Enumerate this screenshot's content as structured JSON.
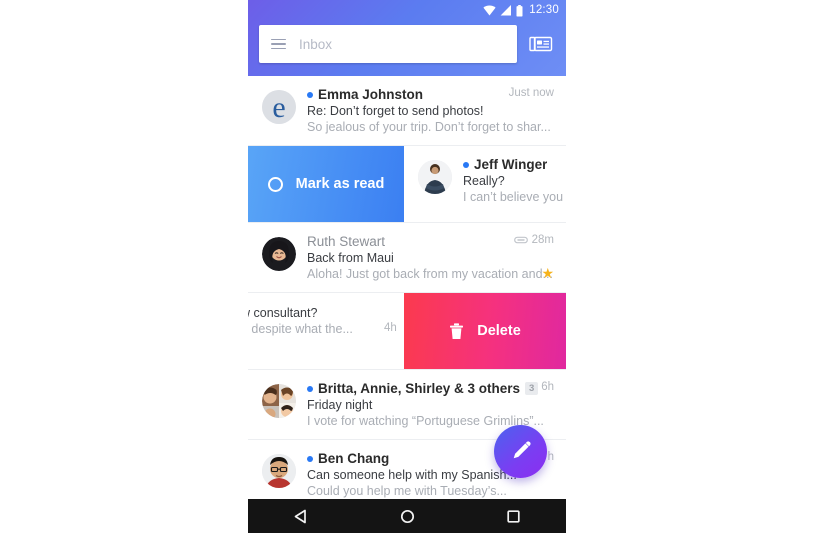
{
  "status_bar": {
    "time": "12:30",
    "icons": [
      "wifi-icon",
      "signal-icon",
      "battery-icon"
    ]
  },
  "header": {
    "accent_gradient_from": "#6d5ee8",
    "accent_gradient_to": "#6e8ef5",
    "search": {
      "placeholder": "Inbox",
      "menu_icon": "hamburger-menu-icon"
    },
    "mail_button_icon": "mail-card-icon"
  },
  "swipe_actions": {
    "mark_as_read": {
      "label": "Mark as read",
      "icon": "circle-outline-icon",
      "gradient_from": "#59a5f7",
      "gradient_to": "#3b7ff2"
    },
    "delete": {
      "label": "Delete",
      "icon": "trash-icon",
      "gradient_from": "#fb3a4e",
      "gradient_to": "#e0289f"
    }
  },
  "messages": [
    {
      "sender": "Emma Johnston",
      "subject": "Re: Don’t forget to send photos!",
      "snippet": "So jealous of your trip. Don’t forget to shar...",
      "time": "Just now",
      "unread": true,
      "avatar": "emma-avatar",
      "badge": "",
      "starred": false,
      "attachment": false
    },
    {
      "sender": "Jeff Winger",
      "subject": "Really?",
      "snippet": "I can’t believe you fe",
      "time": "",
      "unread": true,
      "avatar": "jeff-avatar",
      "badge": "",
      "starred": false,
      "attachment": false,
      "swiped": "mark-as-read"
    },
    {
      "sender": "Ruth Stewart",
      "subject": "Back from Maui",
      "snippet": "Aloha! Just got back from my vacation and...",
      "time": "28m",
      "unread": false,
      "avatar": "ruth-avatar",
      "badge": "",
      "starred": true,
      "attachment": true
    },
    {
      "sender": "",
      "subject": "w consultant?",
      "snippet": "e despite what the...",
      "time": "4h",
      "unread": false,
      "avatar": "",
      "badge": "",
      "starred": false,
      "attachment": false,
      "swiped": "delete"
    },
    {
      "sender": "Britta, Annie, Shirley & 3 others",
      "subject": "Friday night",
      "snippet": "I vote for watching “Portuguese Grimlins”...",
      "time": "6h",
      "unread": true,
      "avatar": "group-avatar",
      "badge": "3",
      "starred": false,
      "attachment": false
    },
    {
      "sender": "Ben Chang",
      "subject": "Can someone help with my Spanish...",
      "snippet": "Could you help me with Tuesday’s...",
      "time": "h",
      "unread": true,
      "avatar": "ben-avatar",
      "badge": "",
      "starred": false,
      "attachment": false
    }
  ],
  "fab": {
    "icon": "compose-pencil-icon",
    "gradient_from": "#4a63ef",
    "gradient_to": "#8b2ef0"
  },
  "nav_bar": {
    "back_icon": "back-triangle-icon",
    "home_icon": "home-circle-icon",
    "recents_icon": "recents-square-icon"
  }
}
